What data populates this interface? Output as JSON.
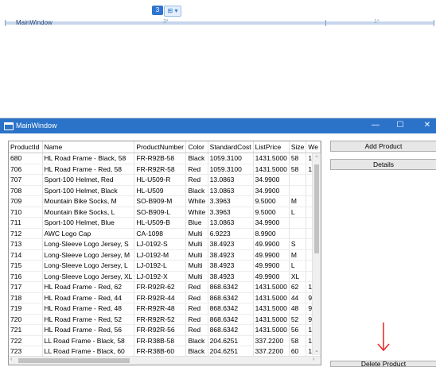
{
  "designer": {
    "row_count": "3",
    "control_tag": "⊞ ▾",
    "window_label": "MainWindow",
    "col_star_1": "3*",
    "col_star_2": "1*"
  },
  "window": {
    "title": "MainWindow",
    "controls": {
      "minimize": "—",
      "maximize": "☐",
      "close": "✕"
    }
  },
  "buttons": {
    "add_product": "Add Product",
    "details": "Details",
    "bottom_partial": "Delete Product"
  },
  "grid": {
    "columns": [
      "ProductId",
      "Name",
      "ProductNumber",
      "Color",
      "StandardCost",
      "ListPrice",
      "Size",
      "We"
    ],
    "rows": [
      [
        "680",
        "HL Road Frame - Black, 58",
        "FR-R92B-58",
        "Black",
        "1059.3100",
        "1431.5000",
        "58",
        "10"
      ],
      [
        "706",
        "HL Road Frame - Red, 58",
        "FR-R92R-58",
        "Red",
        "1059.3100",
        "1431.5000",
        "58",
        "10"
      ],
      [
        "707",
        "Sport-100 Helmet, Red",
        "HL-U509-R",
        "Red",
        "13.0863",
        "34.9900",
        "",
        ""
      ],
      [
        "708",
        "Sport-100 Helmet, Black",
        "HL-U509",
        "Black",
        "13.0863",
        "34.9900",
        "",
        ""
      ],
      [
        "709",
        "Mountain Bike Socks, M",
        "SO-B909-M",
        "White",
        "3.3963",
        "9.5000",
        "M",
        ""
      ],
      [
        "710",
        "Mountain Bike Socks, L",
        "SO-B909-L",
        "White",
        "3.3963",
        "9.5000",
        "L",
        ""
      ],
      [
        "711",
        "Sport-100 Helmet, Blue",
        "HL-U509-B",
        "Blue",
        "13.0863",
        "34.9900",
        "",
        ""
      ],
      [
        "712",
        "AWC Logo Cap",
        "CA-1098",
        "Multi",
        "6.9223",
        "8.9900",
        "",
        ""
      ],
      [
        "713",
        "Long-Sleeve Logo Jersey, S",
        "LJ-0192-S",
        "Multi",
        "38.4923",
        "49.9900",
        "S",
        ""
      ],
      [
        "714",
        "Long-Sleeve Logo Jersey, M",
        "LJ-0192-M",
        "Multi",
        "38.4923",
        "49.9900",
        "M",
        ""
      ],
      [
        "715",
        "Long-Sleeve Logo Jersey, L",
        "LJ-0192-L",
        "Multi",
        "38.4923",
        "49.9900",
        "L",
        ""
      ],
      [
        "716",
        "Long-Sleeve Logo Jersey, XL",
        "LJ-0192-X",
        "Multi",
        "38.4923",
        "49.9900",
        "XL",
        ""
      ],
      [
        "717",
        "HL Road Frame - Red, 62",
        "FR-R92R-62",
        "Red",
        "868.6342",
        "1431.5000",
        "62",
        "10"
      ],
      [
        "718",
        "HL Road Frame - Red, 44",
        "FR-R92R-44",
        "Red",
        "868.6342",
        "1431.5000",
        "44",
        "96"
      ],
      [
        "719",
        "HL Road Frame - Red, 48",
        "FR-R92R-48",
        "Red",
        "868.6342",
        "1431.5000",
        "48",
        "97"
      ],
      [
        "720",
        "HL Road Frame - Red, 52",
        "FR-R92R-52",
        "Red",
        "868.6342",
        "1431.5000",
        "52",
        "99"
      ],
      [
        "721",
        "HL Road Frame - Red, 56",
        "FR-R92R-56",
        "Red",
        "868.6342",
        "1431.5000",
        "56",
        "10"
      ],
      [
        "722",
        "LL Road Frame - Black, 58",
        "FR-R38B-58",
        "Black",
        "204.6251",
        "337.2200",
        "58",
        "11"
      ],
      [
        "723",
        "LL Road Frame - Black, 60",
        "FR-R38B-60",
        "Black",
        "204.6251",
        "337.2200",
        "60",
        "11"
      ]
    ]
  },
  "colors": {
    "titlebar": "#2b73c9",
    "annotation_arrow": "#e8302a"
  }
}
